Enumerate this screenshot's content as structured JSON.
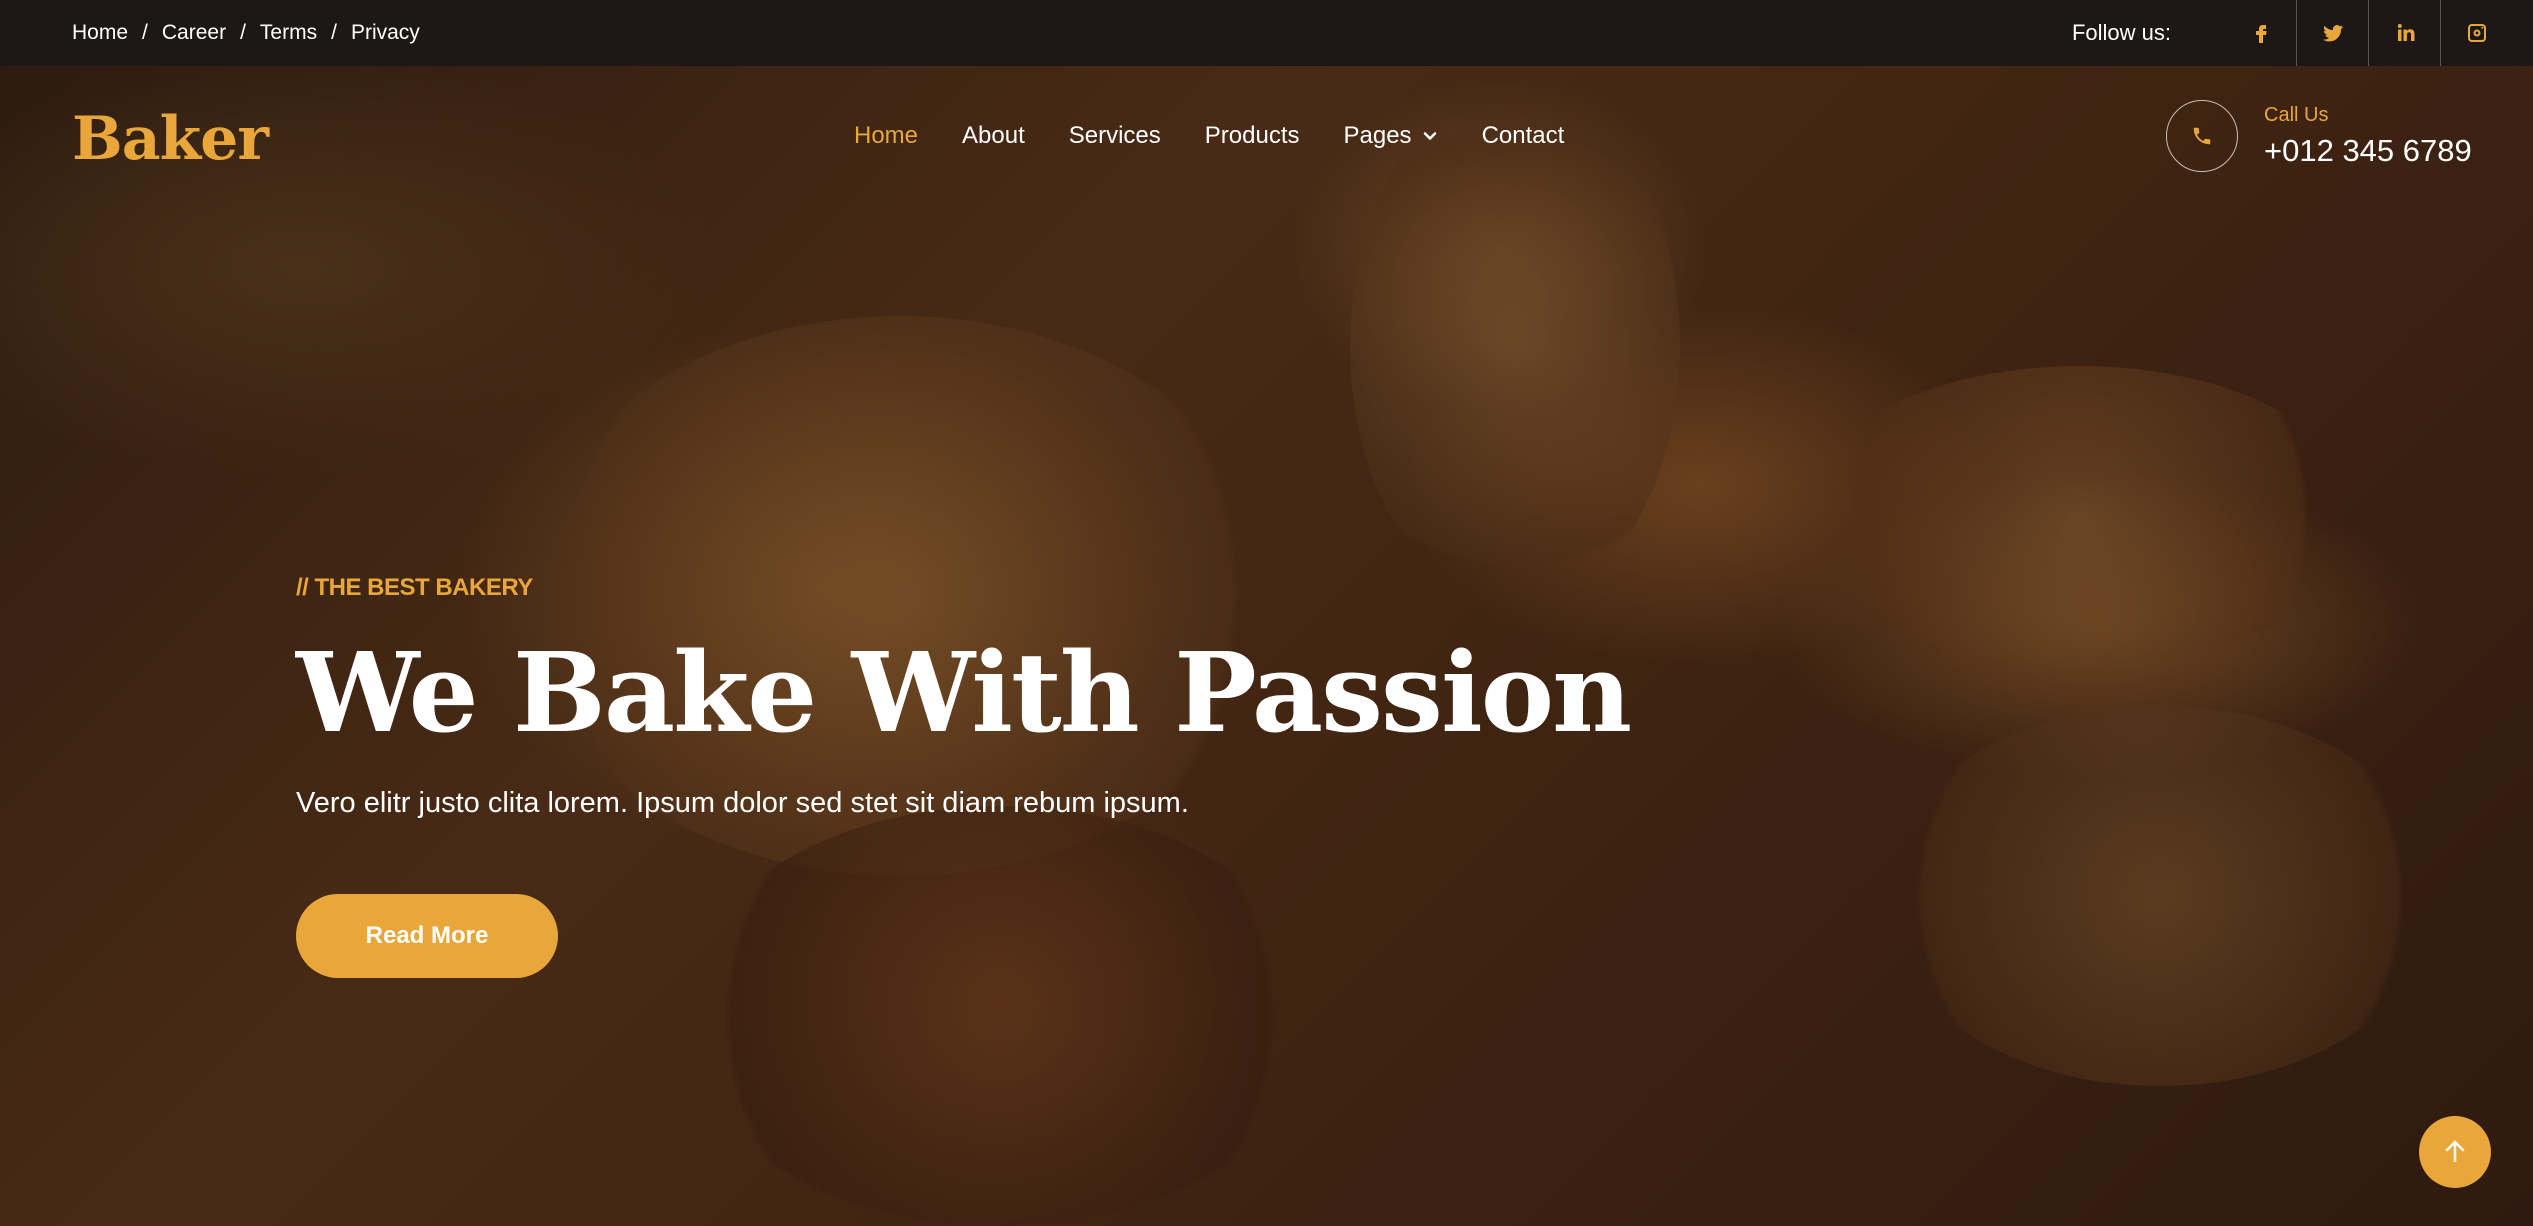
{
  "topbar": {
    "breadcrumb": [
      "Home",
      "Career",
      "Terms",
      "Privacy"
    ],
    "separator": "/",
    "follow_label": "Follow us:",
    "socials": [
      "facebook-icon",
      "twitter-icon",
      "linkedin-icon",
      "instagram-icon"
    ]
  },
  "brand": {
    "logo": "Baker"
  },
  "nav": {
    "items": [
      "Home",
      "About",
      "Services",
      "Products",
      "Pages",
      "Contact"
    ],
    "active": "Home"
  },
  "call": {
    "label": "Call Us",
    "number": "+012 345 6789"
  },
  "hero": {
    "tagline": "// THE BEST BAKERY",
    "headline": "We Bake With Passion",
    "subtext": "Vero elitr justo clita lorem. Ipsum dolor sed stet sit diam rebum ipsum.",
    "button_label": "Read More"
  },
  "colors": {
    "accent": "#e9a63a",
    "topbar": "#1d1816"
  }
}
